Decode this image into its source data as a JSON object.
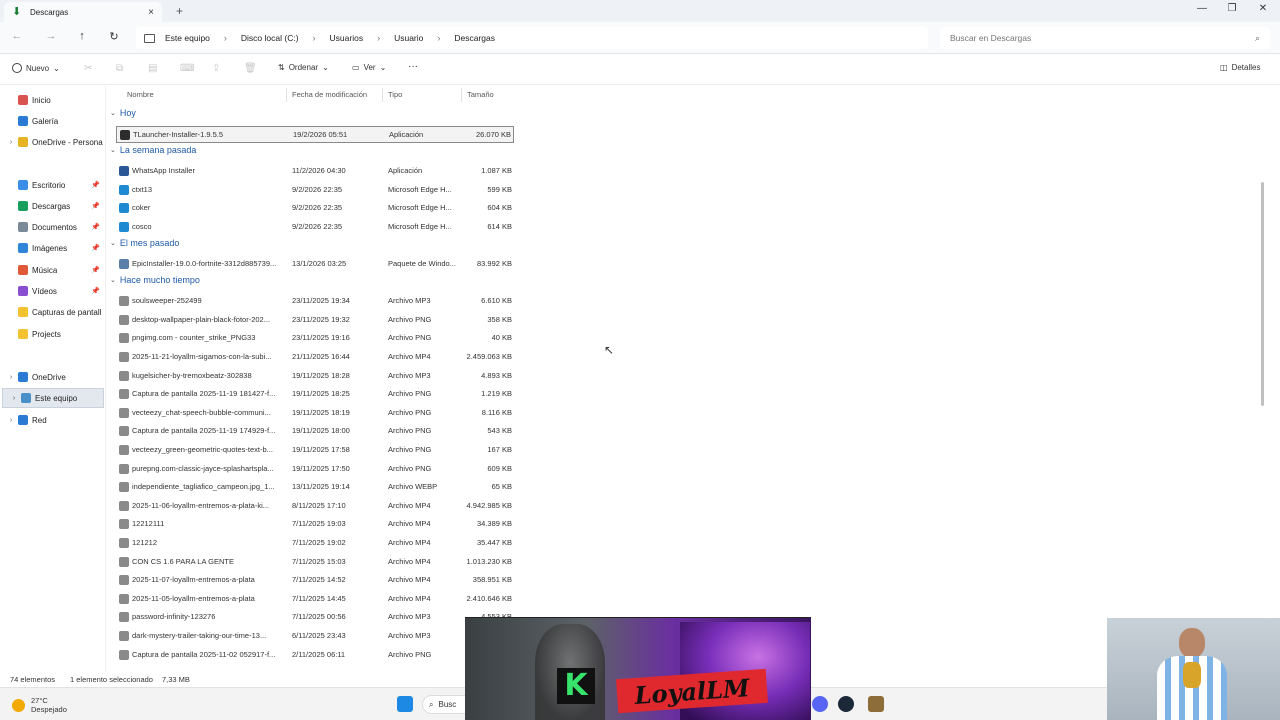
{
  "window": {
    "tab_title": "Descargas",
    "tab_close": "×",
    "new_tab": "+",
    "minimize": "—",
    "maximize": "❐",
    "close": "✕"
  },
  "nav_buttons": {
    "back": "←",
    "forward": "→",
    "up": "↑",
    "refresh": "↻"
  },
  "breadcrumb": [
    "Este equipo",
    "Disco local (C:)",
    "Usuarios",
    "Usuario",
    "Descargas"
  ],
  "breadcrumb_sep": "›",
  "search": {
    "placeholder": "Buscar en Descargas",
    "icon": "⌕"
  },
  "toolbar": {
    "new_label": "Nuevo",
    "sort_label": "Ordenar",
    "view_label": "Ver",
    "more_label": "···",
    "details_label": "Detalles",
    "cut_icon": "✂",
    "copy_icon": "⧉",
    "paste_icon": "▤",
    "rename_icon": "⌨",
    "share_icon": "⇪",
    "delete_icon": "🗑"
  },
  "nav_pane": {
    "items": [
      {
        "label": "Inicio",
        "icon": "home-icon",
        "color": "#d9534f"
      },
      {
        "label": "Galería",
        "icon": "gallery-icon",
        "color": "#2b7bd4"
      },
      {
        "label": "OneDrive - Persona",
        "icon": "cloud-icon",
        "color": "#e6b422"
      },
      {
        "label": "Escritorio",
        "icon": "desktop-icon",
        "color": "#3a8ee6"
      },
      {
        "label": "Descargas",
        "icon": "download-icon",
        "color": "#1a9e5c"
      },
      {
        "label": "Documentos",
        "icon": "document-icon",
        "color": "#7a8a99"
      },
      {
        "label": "Imágenes",
        "icon": "image-icon",
        "color": "#2f86d8"
      },
      {
        "label": "Música",
        "icon": "music-icon",
        "color": "#e05a3a"
      },
      {
        "label": "Vídeos",
        "icon": "video-icon",
        "color": "#8a4fd1"
      },
      {
        "label": "Capturas de pantall",
        "icon": "folder-icon",
        "color": "#f2c230"
      },
      {
        "label": "Projects",
        "icon": "folder-icon",
        "color": "#f2c230"
      },
      {
        "label": "OneDrive",
        "icon": "cloud-icon",
        "color": "#2b7bd4"
      },
      {
        "label": "Este equipo",
        "icon": "pc-icon",
        "color": "#4a90c8"
      },
      {
        "label": "Red",
        "icon": "network-icon",
        "color": "#2b7bd4"
      }
    ],
    "pin": "📌",
    "chevron": "›"
  },
  "columns": {
    "name": "Nombre",
    "date": "Fecha de modificación",
    "type": "Tipo",
    "size": "Tamaño"
  },
  "groups": [
    {
      "label": "Hoy",
      "files": [
        {
          "name": "TLauncher-Installer-1.9.5.5",
          "date": "19/2/2026 05:51",
          "type": "Aplicación",
          "size": "26.070 KB",
          "color": "#2d2d2d"
        }
      ]
    },
    {
      "label": "La semana pasada",
      "files": [
        {
          "name": "WhatsApp Installer",
          "date": "11/2/2026 04:30",
          "type": "Aplicación",
          "size": "1.087 KB",
          "color": "#2b5797"
        },
        {
          "name": "ctxt13",
          "date": "9/2/2026 22:35",
          "type": "Microsoft Edge H...",
          "size": "599 KB",
          "color": "#1f8ad1"
        },
        {
          "name": "coker",
          "date": "9/2/2026 22:35",
          "type": "Microsoft Edge H...",
          "size": "604 KB",
          "color": "#1f8ad1"
        },
        {
          "name": "cosco",
          "date": "9/2/2026 22:35",
          "type": "Microsoft Edge H...",
          "size": "614 KB",
          "color": "#1f8ad1"
        }
      ]
    },
    {
      "label": "El mes pasado",
      "files": [
        {
          "name": "EpicInstaller-19.0.0-fortnite-3312d885739...",
          "date": "13/1/2026 03:25",
          "type": "Paquete de Windo...",
          "size": "83.992 KB",
          "color": "#5a7fa8"
        }
      ]
    },
    {
      "label": "Hace mucho tiempo",
      "files": [
        {
          "name": "soulsweeper-252499",
          "date": "23/11/2025 19:34",
          "type": "Archivo MP3",
          "size": "6.610 KB",
          "color": "#8a8a8a"
        },
        {
          "name": "desktop-wallpaper-plain-black-fotor-202...",
          "date": "23/11/2025 19:32",
          "type": "Archivo PNG",
          "size": "358 KB",
          "color": "#8a8a8a"
        },
        {
          "name": "pngimg.com - counter_strike_PNG33",
          "date": "23/11/2025 19:16",
          "type": "Archivo PNG",
          "size": "40 KB",
          "color": "#8a8a8a"
        },
        {
          "name": "2025-11-21-loyallm-sigamos-con-la-subi...",
          "date": "21/11/2025 16:44",
          "type": "Archivo MP4",
          "size": "2.459.063 KB",
          "color": "#8a8a8a"
        },
        {
          "name": "kugelsicher-by-tremoxbeatz-302838",
          "date": "19/11/2025 18:28",
          "type": "Archivo MP3",
          "size": "4.893 KB",
          "color": "#8a8a8a"
        },
        {
          "name": "Captura de pantalla 2025-11-19 181427-f...",
          "date": "19/11/2025 18:25",
          "type": "Archivo PNG",
          "size": "1.219 KB",
          "color": "#8a8a8a"
        },
        {
          "name": "vecteezy_chat-speech-bubble-communi...",
          "date": "19/11/2025 18:19",
          "type": "Archivo PNG",
          "size": "8.116 KB",
          "color": "#8a8a8a"
        },
        {
          "name": "Captura de pantalla 2025-11-19 174929-f...",
          "date": "19/11/2025 18:00",
          "type": "Archivo PNG",
          "size": "543 KB",
          "color": "#8a8a8a"
        },
        {
          "name": "vecteezy_green-geometric-quotes-text-b...",
          "date": "19/11/2025 17:58",
          "type": "Archivo PNG",
          "size": "167 KB",
          "color": "#8a8a8a"
        },
        {
          "name": "purepng.com-classic-jayce-splashartspla...",
          "date": "19/11/2025 17:50",
          "type": "Archivo PNG",
          "size": "609 KB",
          "color": "#8a8a8a"
        },
        {
          "name": "independiente_tagliafico_campeon.jpg_1...",
          "date": "13/11/2025 19:14",
          "type": "Archivo WEBP",
          "size": "65 KB",
          "color": "#8a8a8a"
        },
        {
          "name": "2025-11-06-loyallm-entremos-a-plata-ki...",
          "date": "8/11/2025 17:10",
          "type": "Archivo MP4",
          "size": "4.942.985 KB",
          "color": "#8a8a8a"
        },
        {
          "name": "12212111",
          "date": "7/11/2025 19:03",
          "type": "Archivo MP4",
          "size": "34.389 KB",
          "color": "#8a8a8a"
        },
        {
          "name": "121212",
          "date": "7/11/2025 19:02",
          "type": "Archivo MP4",
          "size": "35.447 KB",
          "color": "#8a8a8a"
        },
        {
          "name": "CON CS 1.6 PARA LA GENTE",
          "date": "7/11/2025 15:03",
          "type": "Archivo MP4",
          "size": "1.013.230 KB",
          "color": "#8a8a8a"
        },
        {
          "name": "2025-11-07-loyallm-entremos-a-plata",
          "date": "7/11/2025 14:52",
          "type": "Archivo MP4",
          "size": "358.951 KB",
          "color": "#8a8a8a"
        },
        {
          "name": "2025-11-05-loyallm-entremos-a-plata",
          "date": "7/11/2025 14:45",
          "type": "Archivo MP4",
          "size": "2.410.646 KB",
          "color": "#8a8a8a"
        },
        {
          "name": "password-infinity-123276",
          "date": "7/11/2025 00:56",
          "type": "Archivo MP3",
          "size": "4.553 KB",
          "color": "#8a8a8a"
        },
        {
          "name": "dark-mystery-trailer-taking-our-time-13...",
          "date": "6/11/2025 23:43",
          "type": "Archivo MP3",
          "size": "",
          "color": "#8a8a8a"
        },
        {
          "name": "Captura de pantalla 2025-11-02 052917-f...",
          "date": "2/11/2025 06:11",
          "type": "Archivo PNG",
          "size": "",
          "color": "#8a8a8a"
        }
      ]
    }
  ],
  "status": {
    "count": "74 elementos",
    "selection": "1 elemento seleccionado",
    "size": "7,33 MB"
  },
  "taskbar": {
    "temperature": "27°C",
    "condition": "Despejado",
    "search_label": "Busc",
    "apps": [
      {
        "name": "windows-start-icon",
        "color": "#1e88e5"
      },
      {
        "name": "discord-icon",
        "color": "#5865f2"
      },
      {
        "name": "steam-icon",
        "color": "#1b2838"
      },
      {
        "name": "package-icon",
        "color": "#8d6e3a"
      }
    ]
  },
  "overlay": {
    "brand_text": "LoyalLM",
    "k_logo": "K"
  }
}
